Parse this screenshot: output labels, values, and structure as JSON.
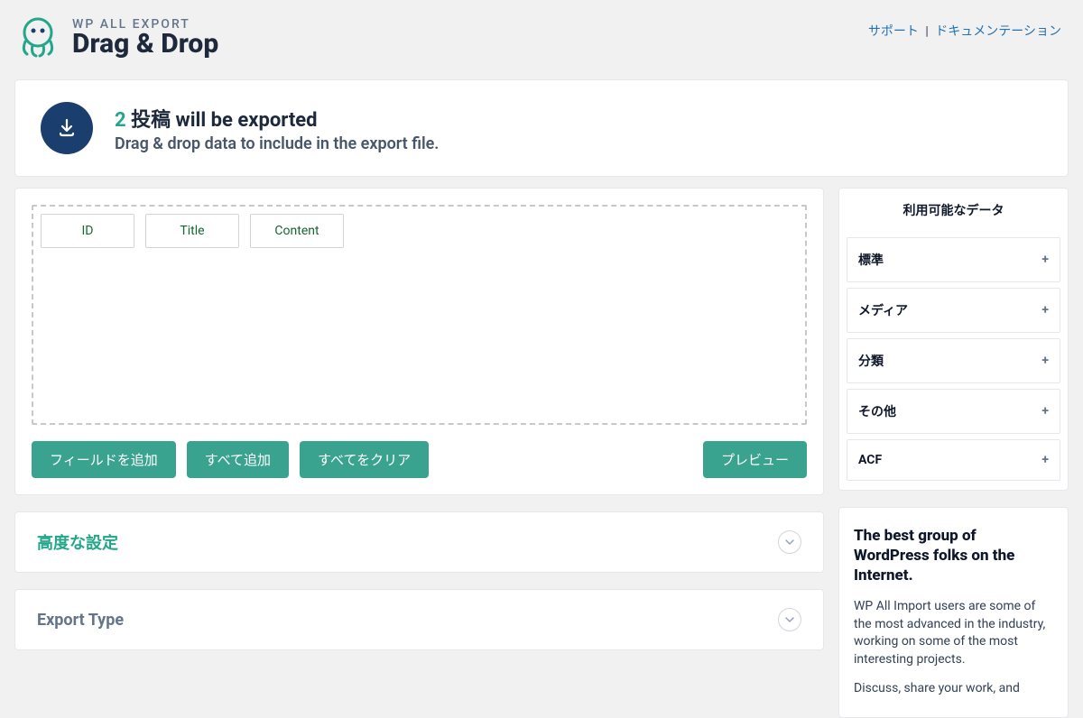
{
  "brand": {
    "small": "WP ALL EXPORT",
    "big": "Drag & Drop"
  },
  "header_links": {
    "support": "サポート",
    "documentation": "ドキュメンテーション"
  },
  "intro": {
    "count": "2",
    "title_rest": " 投稿 will be exported",
    "subtitle": "Drag & drop data to include in the export file."
  },
  "fields": {
    "items": [
      {
        "label": "ID"
      },
      {
        "label": "Title"
      },
      {
        "label": "Content"
      }
    ]
  },
  "buttons": {
    "add_field": "フィールドを追加",
    "add_all": "すべて追加",
    "clear_all": "すべてをクリア",
    "preview": "プレビュー"
  },
  "sections": {
    "advanced": "高度な設定",
    "export_type": "Export Type"
  },
  "available_data": {
    "header": "利用可能なデータ",
    "groups": [
      {
        "label": "標準"
      },
      {
        "label": "メディア"
      },
      {
        "label": "分類"
      },
      {
        "label": "その他"
      },
      {
        "label": "ACF"
      }
    ]
  },
  "promo": {
    "title": "The best group of WordPress folks on the Internet.",
    "p1": "WP All Import users are some of the most advanced in the industry, working on some of the most interesting projects.",
    "p2": "Discuss, share your work, and"
  }
}
